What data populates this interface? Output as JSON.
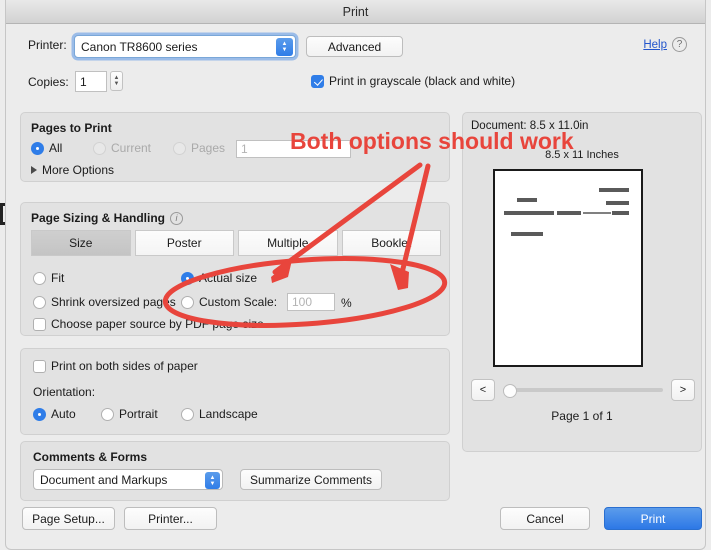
{
  "window": {
    "title": "Print"
  },
  "printer": {
    "label": "Printer:",
    "value": "Canon TR8600 series",
    "advanced_label": "Advanced",
    "help_label": "Help",
    "help_icon": "question-circle-icon"
  },
  "copies": {
    "label": "Copies:",
    "value": "1"
  },
  "grayscale": {
    "label": "Print in grayscale (black and white)",
    "checked": true
  },
  "pages_to_print": {
    "title": "Pages to Print",
    "options": [
      {
        "label": "All",
        "selected": true,
        "disabled": false
      },
      {
        "label": "Current",
        "selected": false,
        "disabled": true
      },
      {
        "label": "Pages",
        "selected": false,
        "disabled": true
      }
    ],
    "pages_field_value": "1",
    "more_options_label": "More Options",
    "more_options_icon": "triangle-right-icon"
  },
  "page_sizing": {
    "title": "Page Sizing & Handling",
    "info_icon": "info-circle-icon",
    "tabs": [
      {
        "label": "Size",
        "selected": true
      },
      {
        "label": "Poster",
        "selected": false
      },
      {
        "label": "Multiple",
        "selected": false
      },
      {
        "label": "Booklet",
        "selected": false
      }
    ],
    "options": [
      {
        "label": "Fit",
        "selected": false
      },
      {
        "label": "Actual size",
        "selected": true
      },
      {
        "label": "Shrink oversized pages",
        "selected": false
      },
      {
        "label": "Custom Scale:",
        "selected": false
      }
    ],
    "custom_scale_value": "100",
    "percent_label": "%",
    "paper_source_label": "Choose paper source by PDF page size",
    "paper_source_checked": false
  },
  "duplex": {
    "label": "Print on both sides of paper",
    "checked": false
  },
  "orientation": {
    "title": "Orientation:",
    "options": [
      {
        "label": "Auto",
        "selected": true
      },
      {
        "label": "Portrait",
        "selected": false
      },
      {
        "label": "Landscape",
        "selected": false
      }
    ]
  },
  "comments_forms": {
    "title": "Comments & Forms",
    "value": "Document and Markups",
    "summarize_label": "Summarize Comments"
  },
  "preview": {
    "document_size": "Document: 8.5 x 11.0in",
    "paper_size": "8.5 x 11 Inches",
    "page_status": "Page 1 of 1",
    "prev_label": "<",
    "next_label": ">"
  },
  "footer": {
    "page_setup_label": "Page Setup...",
    "printer_label": "Printer...",
    "cancel_label": "Cancel",
    "print_label": "Print"
  },
  "annotation": {
    "text": "Both options should work",
    "color": "#e8453c"
  }
}
